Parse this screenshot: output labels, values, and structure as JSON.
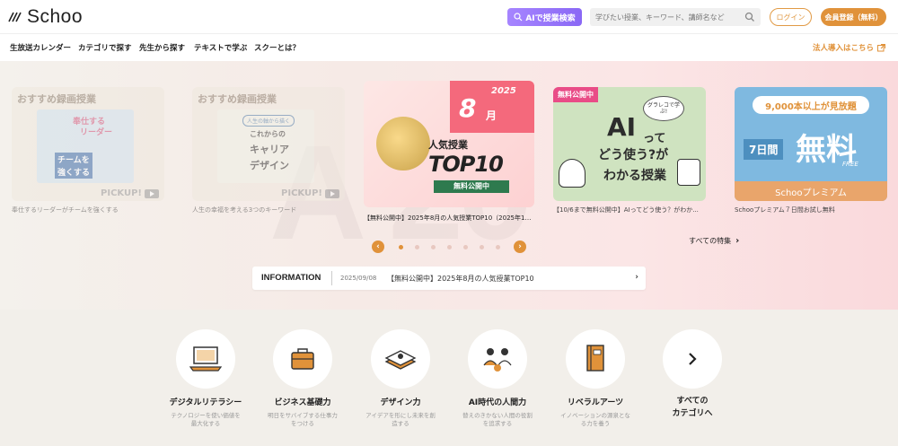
{
  "header": {
    "logo_text": "Schoo",
    "ai_search_label": "AIで授業検索",
    "search_placeholder": "学びたい授業、キーワード、講師名など",
    "login_label": "ログイン",
    "register_label": "会員登録（無料）"
  },
  "nav": {
    "items": [
      "生放送カレンダー",
      "カテゴリで探す",
      "先生から探す",
      "テキストで学ぶ",
      "スクーとは？"
    ],
    "corporate_link": "法人導入はこちら"
  },
  "carousel": {
    "cards": [
      {
        "tag": "おすすめ録画授業",
        "inner_lines": [
          "奉仕する",
          "リーダー",
          "チームを",
          "強くする"
        ],
        "pickup": "PICKUP!",
        "caption": "奉仕するリーダーがチームを強くする"
      },
      {
        "tag": "おすすめ録画授業",
        "inner_lines": [
          "人生の軸から描く",
          "これからの",
          "キャリア",
          "デザイン"
        ],
        "pickup": "PICKUP!",
        "caption": "人生の幸福を考える3つのキーワード"
      },
      {
        "year": "2025",
        "month": "8",
        "month_unit": "月",
        "sub": "人気授業",
        "big": "TOP10",
        "ribbon": "無料公開中",
        "caption": "【無料公開中】2025年8月の人気授業TOP10（2025年10..."
      },
      {
        "badge": "無料公開中",
        "bubble": "グラレコで学ぶ!",
        "line1": "AI",
        "line2": "って",
        "line3": "どう使う?が",
        "line4": "わかる授業",
        "caption": "【10/6まで無料公開中】AIってどう使う？がわか..."
      },
      {
        "top": "9,000本以上が見放題",
        "days": "7日間",
        "free": "無料",
        "free_en": "FREE",
        "bar": "Schooプレミアム",
        "caption": "Schooプレミアム７日間お試し無料"
      }
    ],
    "dot_count": 8,
    "active_dot": 0,
    "all_features": "すべての特集"
  },
  "info": {
    "label": "INFORMATION",
    "date": "2025/09/08",
    "text": "【無料公開中】2025年8月の人気授業TOP10"
  },
  "categories": [
    {
      "label": "デジタルリテラシー",
      "desc1": "テクノロジーを使い価値を",
      "desc2": "最大化する",
      "icon": "laptop-icon"
    },
    {
      "label": "ビジネス基礎力",
      "desc1": "明日をサバイブする仕事力",
      "desc2": "をつける",
      "icon": "briefcase-icon"
    },
    {
      "label": "デザイン力",
      "desc1": "アイデアを形にし未来を創",
      "desc2": "造する",
      "icon": "design-tools-icon"
    },
    {
      "label": "AI時代の人間力",
      "desc1": "替えのきかない人間の役割",
      "desc2": "を追求する",
      "icon": "people-icon"
    },
    {
      "label": "リベラルアーツ",
      "desc1": "イノベーションの源泉とな",
      "desc2": "る力を養う",
      "icon": "book-icon"
    },
    {
      "label": "すべての",
      "label2": "カテゴリへ",
      "icon": "chevron-right-icon"
    }
  ],
  "colors": {
    "accent": "#e0923a",
    "ai_purple": "#9a78f8",
    "pink": "#f4697c"
  }
}
